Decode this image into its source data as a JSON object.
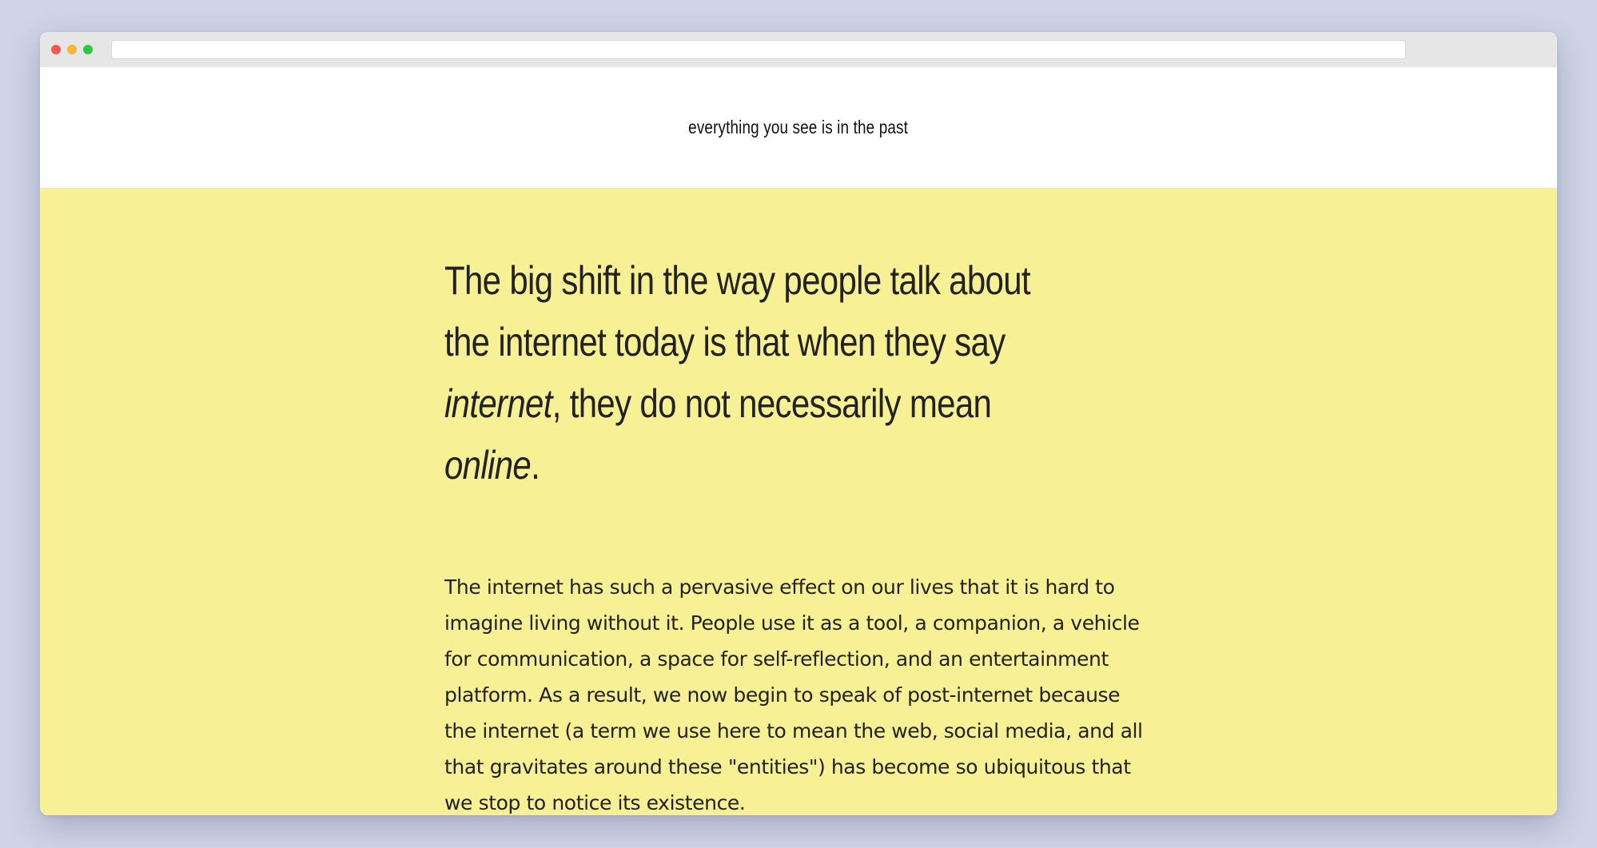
{
  "site": {
    "title": "everything you see is in the past"
  },
  "lead": {
    "part1": "The big shift in the way people talk about the internet today is that when they say ",
    "em1": "internet",
    "part2": ", they do not necessarily mean ",
    "em2": "online",
    "part3": "."
  },
  "body": {
    "paragraph": "The internet has such a pervasive effect on our lives that it is hard to imagine living without it. People use it as a tool, a companion, a vehicle for communication, a space for self-reflection, and an entertainment platform. As a result, we now begin to speak of post-internet because the internet (a term we use here to mean the web, social media, and all that gravitates around these \"entities\") has become so ubiquitous that we stop to notice its existence."
  },
  "colors": {
    "page_background": "#cfd4e6",
    "content_background": "#f7f094",
    "text": "#222222"
  },
  "icons": {
    "close": "traffic-light-close-icon",
    "minimize": "traffic-light-minimize-icon",
    "zoom": "traffic-light-zoom-icon"
  }
}
